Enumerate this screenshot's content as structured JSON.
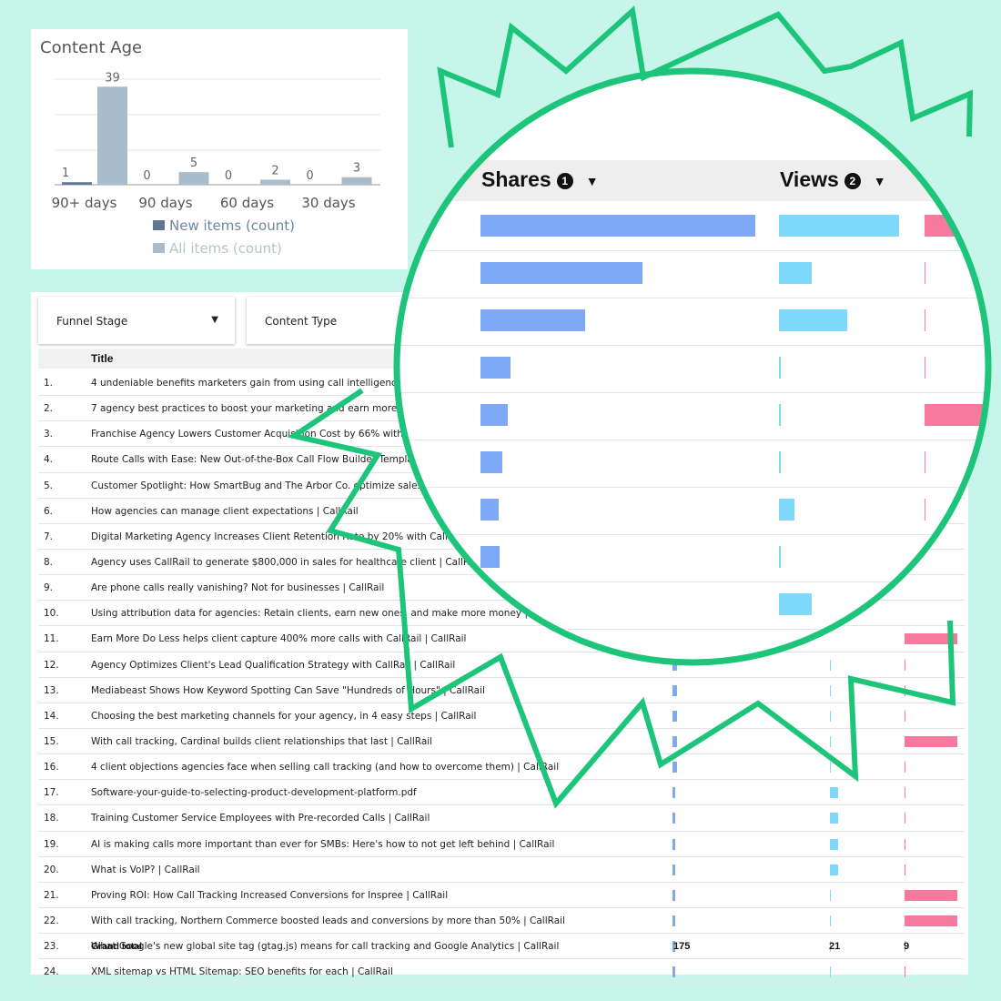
{
  "content_age": {
    "title": "Content Age",
    "legend_new": "New items (count)",
    "legend_all": "All items (count)",
    "chart_data": {
      "type": "bar",
      "categories": [
        "90+ days",
        "90 days",
        "60 days",
        "30 days"
      ],
      "series": [
        {
          "name": "New items (count)",
          "values": [
            1,
            0,
            0,
            0
          ],
          "color": "#5f7890"
        },
        {
          "name": "All items (count)",
          "values": [
            39,
            5,
            2,
            3
          ],
          "color": "#a9bccb"
        }
      ],
      "ylim": [
        0,
        42
      ],
      "grid": true
    }
  },
  "filters": {
    "funnel_stage": "Funnel Stage",
    "content_type": "Content Type"
  },
  "table": {
    "title_header": "Title",
    "grand_total_label": "Grand total",
    "totals": {
      "shares": "175",
      "views": "21",
      "third": "9"
    },
    "rows": [
      {
        "n": "1.",
        "title": "4 undeniable benefits marketers gain from using call intelligence tools"
      },
      {
        "n": "2.",
        "title": "7 agency best practices to boost your marketing and earn more clients"
      },
      {
        "n": "3.",
        "title": "Franchise Agency Lowers Customer Acquisition Cost by 66% with CallRail"
      },
      {
        "n": "4.",
        "title": "Route Calls with Ease: New Out-of-the-Box Call Flow Builder Templates | CallRail"
      },
      {
        "n": "5.",
        "title": "Customer Spotlight: How SmartBug and The Arbor Co. optimize sales and marketing"
      },
      {
        "n": "6.",
        "title": "How agencies can manage client expectations | CallRail"
      },
      {
        "n": "7.",
        "title": "Digital Marketing Agency Increases Client Retention Rate by 20% with Call Analytics"
      },
      {
        "n": "8.",
        "title": "Agency uses CallRail to generate $800,000 in sales for healthcare client | CallRail"
      },
      {
        "n": "9.",
        "title": "Are phone calls really vanishing? Not for businesses | CallRail"
      },
      {
        "n": "10.",
        "title": "Using attribution data for agencies: Retain clients, earn new ones, and make more money | CallRail"
      },
      {
        "n": "11.",
        "title": "Earn More Do Less helps client capture 400% more calls with CallRail | CallRail"
      },
      {
        "n": "12.",
        "title": "Agency Optimizes Client's Lead Qualification Strategy with CallRail | CallRail"
      },
      {
        "n": "13.",
        "title": "Mediabeast Shows How Keyword Spotting Can Save \"Hundreds of Hours\" | CallRail"
      },
      {
        "n": "14.",
        "title": "Choosing the best marketing channels for your agency, in 4 easy steps | CallRail"
      },
      {
        "n": "15.",
        "title": "With call tracking, Cardinal builds client relationships that last | CallRail"
      },
      {
        "n": "16.",
        "title": "4 client objections agencies face when selling call tracking (and how to overcome them) | CallRail"
      },
      {
        "n": "17.",
        "title": "Software-your-guide-to-selecting-product-development-platform.pdf"
      },
      {
        "n": "18.",
        "title": "Training Customer Service Employees with Pre-recorded Calls | CallRail"
      },
      {
        "n": "19.",
        "title": "AI is making calls more important than ever for SMBs: Here's how to not get left behind | CallRail"
      },
      {
        "n": "20.",
        "title": "What is VoIP? | CallRail"
      },
      {
        "n": "21.",
        "title": "Proving ROI: How Call Tracking Increased Conversions for Inspree | CallRail"
      },
      {
        "n": "22.",
        "title": "With call tracking, Northern Commerce boosted leads and conversions by more than 50% | CallRail"
      },
      {
        "n": "23.",
        "title": "What Google's new global site tag (gtag.js) means for call tracking and Google Analytics | CallRail"
      },
      {
        "n": "24.",
        "title": "XML sitemap vs HTML Sitemap: SEO benefits for each | CallRail"
      }
    ]
  },
  "magnifier": {
    "shares_label": "Shares",
    "shares_badge": "1",
    "views_label": "Views",
    "views_badge": "2",
    "shares_fractions": [
      1.0,
      0.59,
      0.38,
      0.11,
      0.1,
      0.08,
      0.06,
      0.07,
      0.0
    ],
    "views_fractions": [
      1.0,
      0.27,
      0.57,
      0.01,
      0.01,
      0.01,
      0.13,
      0.01,
      0.27
    ],
    "third_fractions": [
      1.0,
      0.0,
      0.0,
      0.0,
      1.0,
      0.0,
      0.0,
      0.0,
      0.0
    ],
    "colors": {
      "shares": "#7fa8f7",
      "views": "#7ed8f9",
      "third": "#f7799e",
      "ring": "#1cc57a"
    }
  }
}
